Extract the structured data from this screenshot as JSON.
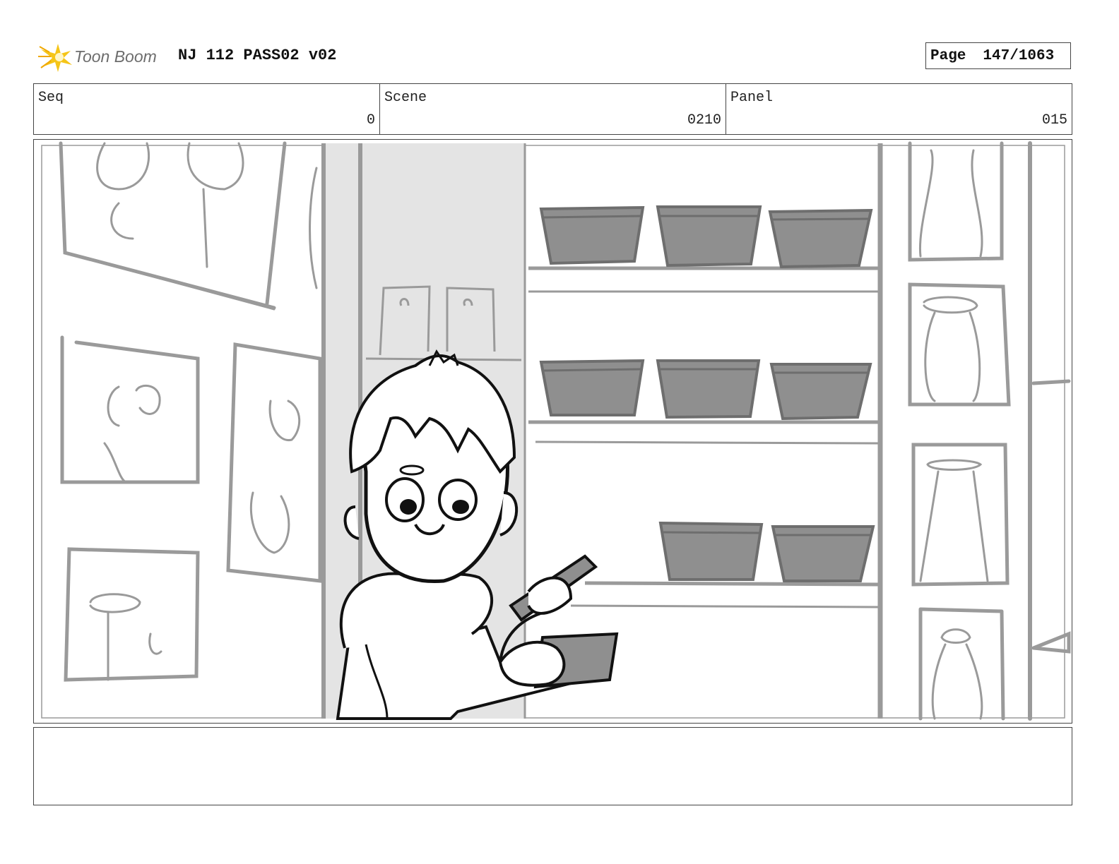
{
  "header": {
    "logo_text": "Toon Boom",
    "title": "NJ 112 PASS02 v02",
    "page_label": "Page",
    "page_value": "147/1063"
  },
  "info": {
    "seq_label": "Seq",
    "seq_value": "0",
    "scene_label": "Scene",
    "scene_value": "0210",
    "panel_label": "Panel",
    "panel_value": "015"
  },
  "notes": {
    "text": ""
  },
  "colors": {
    "sketch_gray": "#9a9a9a",
    "bowl_fill": "#8f8f8f",
    "pillar_fill": "#e4e4e4",
    "logo_star": "#f5c518"
  }
}
